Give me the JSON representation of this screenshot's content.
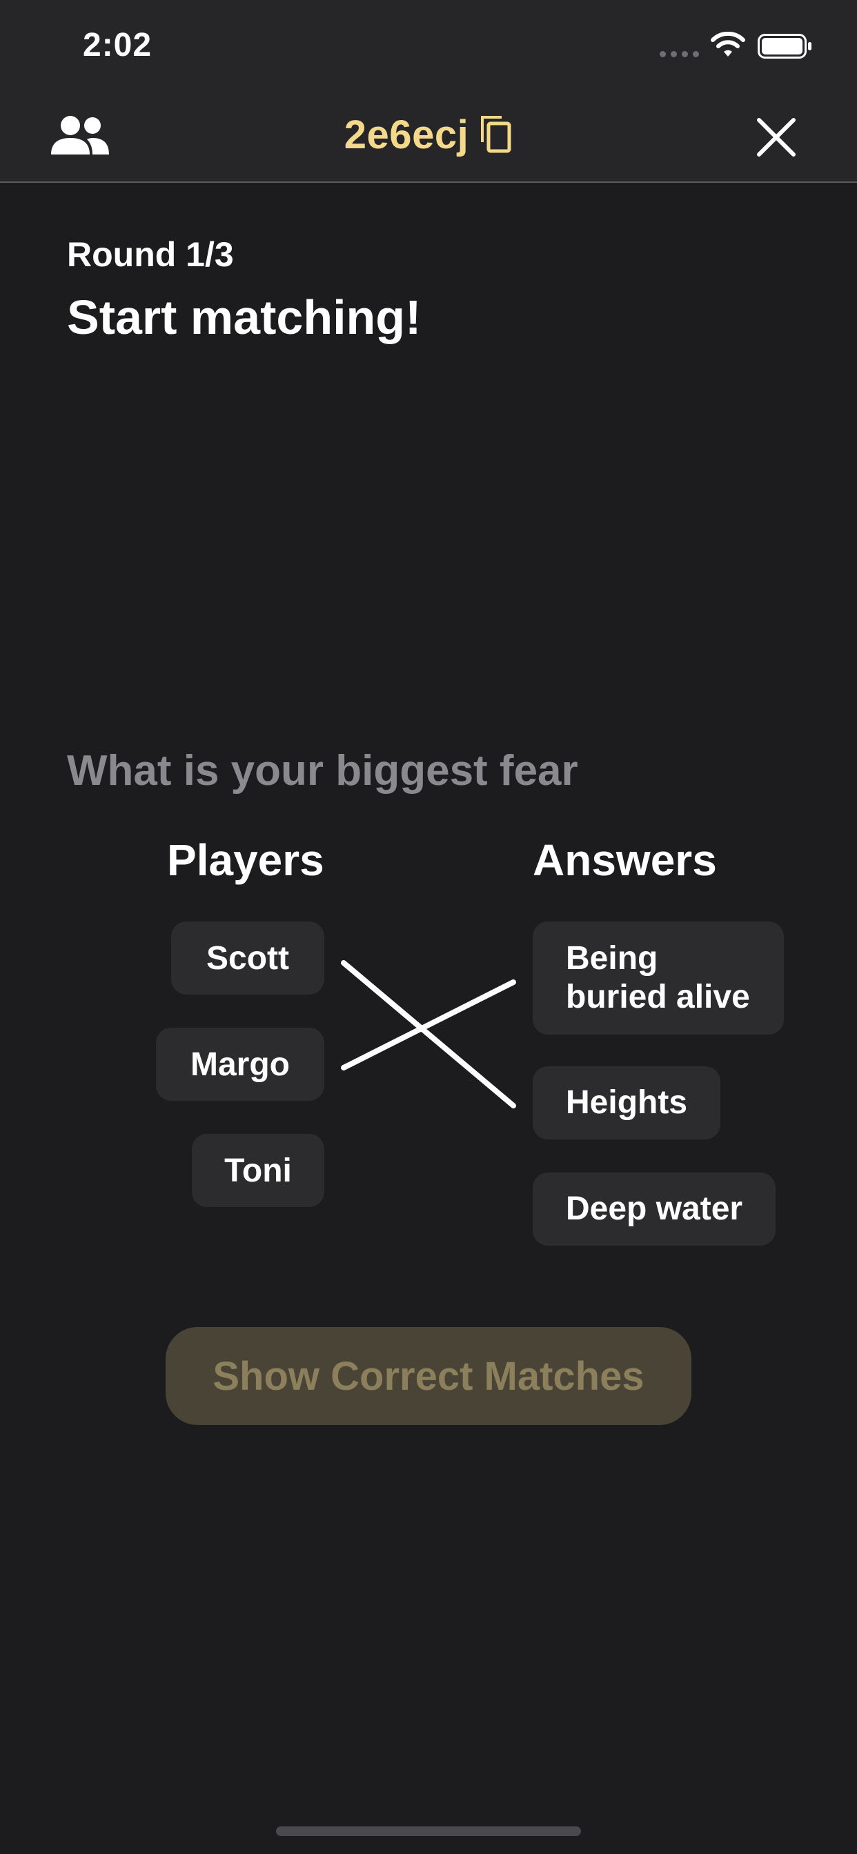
{
  "status_bar": {
    "time": "2:02"
  },
  "nav": {
    "room_code": "2e6ecj",
    "left_icon": "people-icon",
    "copy_icon": "copy-icon",
    "close_icon": "close-icon"
  },
  "header": {
    "round": "Round 1/3",
    "title": "Start matching!"
  },
  "question": "What is your biggest fear",
  "columns": {
    "players_label": "Players",
    "answers_label": "Answers"
  },
  "players": [
    "Scott",
    "Margo",
    "Toni"
  ],
  "answers": [
    "Being\nburied alive",
    "Heights",
    "Deep water"
  ],
  "matches": [
    {
      "player": "Scott",
      "answer": "Heights"
    },
    {
      "player": "Margo",
      "answer": "Being\nburied alive"
    }
  ],
  "action_button": {
    "label": "Show Correct Matches",
    "state": "disabled"
  },
  "colors": {
    "background": "#1c1c1e",
    "top_bar": "#262628",
    "accent": "#f5d98a",
    "chip": "#2c2c2e",
    "muted_text": "#8a8a8e",
    "button_bg": "#4a4436",
    "button_text": "#8c7f5c"
  }
}
